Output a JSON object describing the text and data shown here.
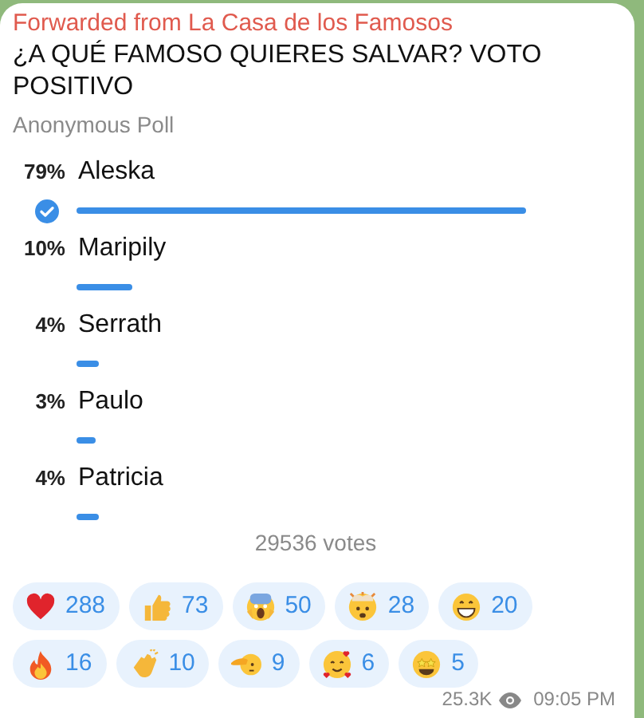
{
  "forwarded_from": "Forwarded from La Casa de los Famosos",
  "poll": {
    "question": "¿A QUÉ FAMOSO QUIERES SALVAR? VOTO POSITIVO",
    "type": "Anonymous Poll",
    "options": [
      {
        "percent": "79%",
        "label": "Aleska",
        "selected": true
      },
      {
        "percent": "10%",
        "label": "Maripily",
        "selected": false
      },
      {
        "percent": "4%",
        "label": "Serrath",
        "selected": false
      },
      {
        "percent": "3%",
        "label": "Paulo",
        "selected": false
      },
      {
        "percent": "4%",
        "label": "Patricia",
        "selected": false
      }
    ],
    "total": "29536 votes"
  },
  "reactions": [
    {
      "kind": "heart",
      "count": "288"
    },
    {
      "kind": "thumbs",
      "count": "73"
    },
    {
      "kind": "scream",
      "count": "50"
    },
    {
      "kind": "mindblown",
      "count": "28"
    },
    {
      "kind": "grin",
      "count": "20"
    },
    {
      "kind": "fire",
      "count": "16"
    },
    {
      "kind": "clap",
      "count": "10"
    },
    {
      "kind": "salute",
      "count": "9"
    },
    {
      "kind": "hearts",
      "count": "6"
    },
    {
      "kind": "starstruck",
      "count": "5"
    }
  ],
  "views": "25.3K",
  "time": "09:05 PM"
}
